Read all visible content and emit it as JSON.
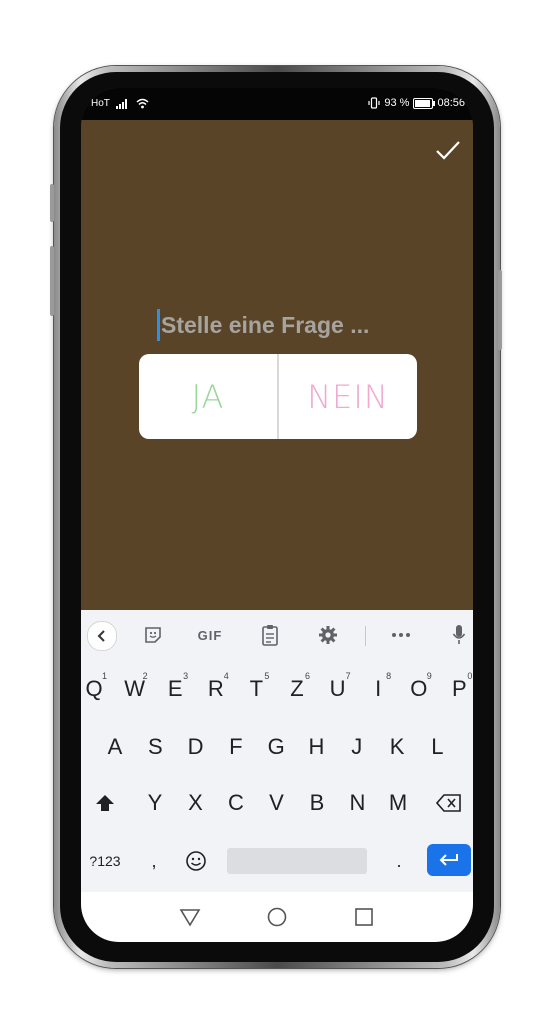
{
  "status_bar": {
    "carrier": "HoT",
    "battery_percent": "93 %",
    "time": "08:56",
    "battery_level": 0.93,
    "icons": [
      "signal-icon",
      "wifi-icon",
      "vibrate-icon",
      "battery-icon"
    ]
  },
  "editor": {
    "question_placeholder": "Stelle eine Frage ...",
    "background_color": "#5a4428",
    "done_icon": "checkmark-icon"
  },
  "poll": {
    "option_yes": "JA",
    "option_no": "NEIN",
    "yes_color": "#9ad79a",
    "no_color": "#f0a9cf"
  },
  "keyboard": {
    "toolbar": {
      "gif_label": "GIF",
      "icons": [
        "back-chevron-icon",
        "sticker-icon",
        "gif-icon",
        "clipboard-icon",
        "settings-gear-icon",
        "more-icon",
        "microphone-icon"
      ]
    },
    "row1": [
      "Q",
      "W",
      "E",
      "R",
      "T",
      "Z",
      "U",
      "I",
      "O",
      "P"
    ],
    "row1_hints": [
      "1",
      "2",
      "3",
      "4",
      "5",
      "6",
      "7",
      "8",
      "9",
      "0"
    ],
    "row2": [
      "A",
      "S",
      "D",
      "F",
      "G",
      "H",
      "J",
      "K",
      "L"
    ],
    "row3": [
      "Y",
      "X",
      "C",
      "V",
      "B",
      "N",
      "M"
    ],
    "symbols_label": "?123",
    "comma": ",",
    "period": ".",
    "enter_color": "#1a73e8"
  },
  "nav_bar": {
    "icons": [
      "back-triangle-icon",
      "home-circle-icon",
      "recents-square-icon"
    ]
  }
}
